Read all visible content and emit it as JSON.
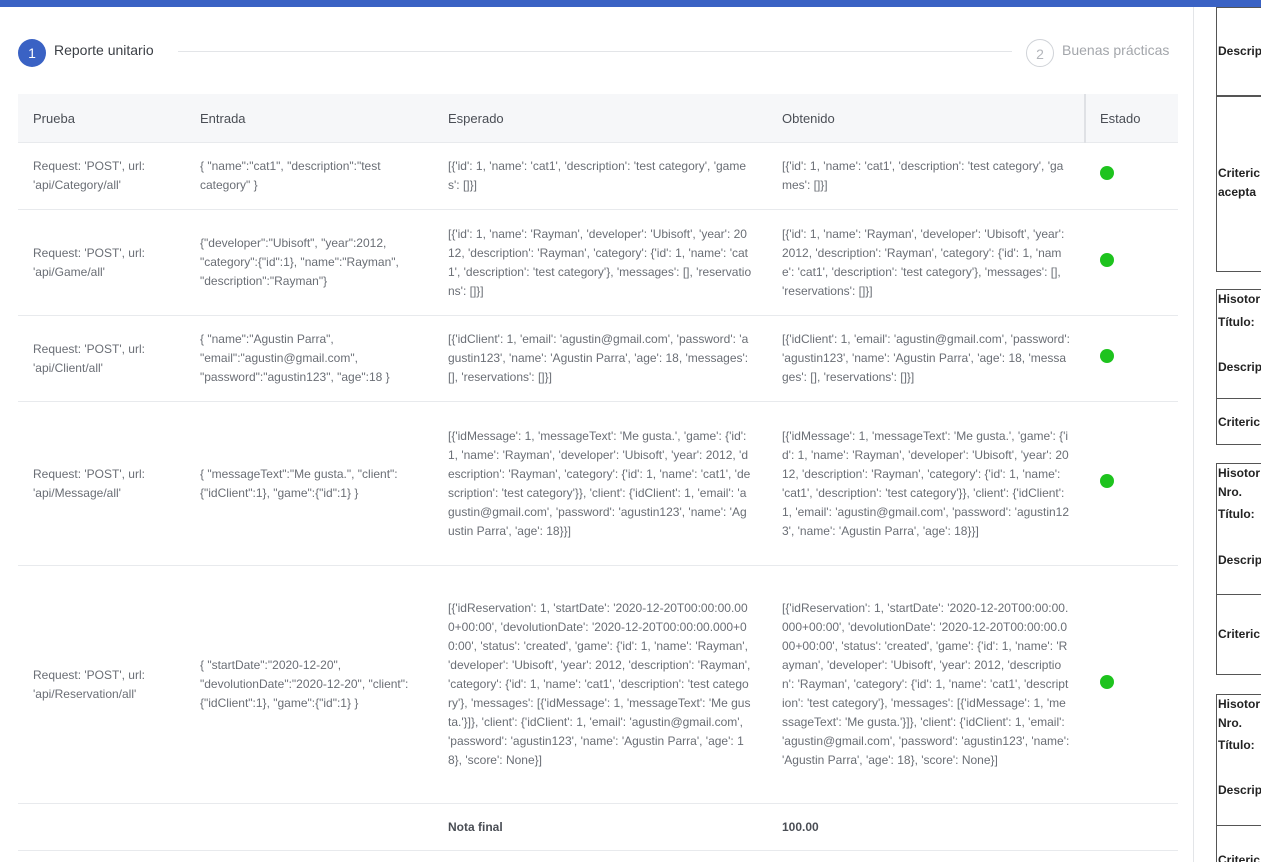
{
  "stepper": {
    "steps": [
      {
        "number": "1",
        "label": "Reporte unitario"
      },
      {
        "number": "2",
        "label": "Buenas prácticas"
      }
    ]
  },
  "table": {
    "headers": [
      "Prueba",
      "Entrada",
      "Esperado",
      "Obtenido",
      "Estado"
    ],
    "rows": [
      {
        "prueba": "Request: 'POST', url: 'api/Category/all'",
        "entrada": "{ \"name\":\"cat1\", \"description\":\"test category\" }",
        "esperado": "[{'id': 1, 'name': 'cat1', 'description': 'test category', 'games': []}]",
        "obtenido": "[{'id': 1, 'name': 'cat1', 'description': 'test category', 'games': []}]",
        "estado": "ok"
      },
      {
        "prueba": "Request: 'POST', url: 'api/Game/all'",
        "entrada": "{\"developer\":\"Ubisoft\", \"year\":2012, \"category\":{\"id\":1}, \"name\":\"Rayman\", \"description\":\"Rayman\"}",
        "esperado": "[{'id': 1, 'name': 'Rayman', 'developer': 'Ubisoft', 'year': 2012, 'description': 'Rayman', 'category': {'id': 1, 'name': 'cat1', 'description': 'test category'}, 'messages': [], 'reservations': []}]",
        "obtenido": "[{'id': 1, 'name': 'Rayman', 'developer': 'Ubisoft', 'year': 2012, 'description': 'Rayman', 'category': {'id': 1, 'name': 'cat1', 'description': 'test category'}, 'messages': [], 'reservations': []}]",
        "estado": "ok"
      },
      {
        "prueba": "Request: 'POST', url: 'api/Client/all'",
        "entrada": "{ \"name\":\"Agustin Parra\", \"email\":\"agustin@gmail.com\", \"password\":\"agustin123\", \"age\":18 }",
        "esperado": "[{'idClient': 1, 'email': 'agustin@gmail.com', 'password': 'agustin123', 'name': 'Agustin Parra', 'age': 18, 'messages': [], 'reservations': []}]",
        "obtenido": "[{'idClient': 1, 'email': 'agustin@gmail.com', 'password': 'agustin123', 'name': 'Agustin Parra', 'age': 18, 'messages': [], 'reservations': []}]",
        "estado": "ok"
      },
      {
        "prueba": "Request: 'POST', url: 'api/Message/all'",
        "entrada": "{ \"messageText\":\"Me gusta.\", \"client\":{\"idClient\":1}, \"game\":{\"id\":1} }",
        "esperado": "[{'idMessage': 1, 'messageText': 'Me gusta.', 'game': {'id': 1, 'name': 'Rayman', 'developer': 'Ubisoft', 'year': 2012, 'description': 'Rayman', 'category': {'id': 1, 'name': 'cat1', 'description': 'test category'}}, 'client': {'idClient': 1, 'email': 'agustin@gmail.com', 'password': 'agustin123', 'name': 'Agustin Parra', 'age': 18}}]",
        "obtenido": "[{'idMessage': 1, 'messageText': 'Me gusta.', 'game': {'id': 1, 'name': 'Rayman', 'developer': 'Ubisoft', 'year': 2012, 'description': 'Rayman', 'category': {'id': 1, 'name': 'cat1', 'description': 'test category'}}, 'client': {'idClient': 1, 'email': 'agustin@gmail.com', 'password': 'agustin123', 'name': 'Agustin Parra', 'age': 18}}]",
        "estado": "ok"
      },
      {
        "prueba": "Request: 'POST', url: 'api/Reservation/all'",
        "entrada": "{ \"startDate\":\"2020-12-20\", \"devolutionDate\":\"2020-12-20\", \"client\":{\"idClient\":1}, \"game\":{\"id\":1} }",
        "esperado": "[{'idReservation': 1, 'startDate': '2020-12-20T00:00:00.000+00:00', 'devolutionDate': '2020-12-20T00:00:00.000+00:00', 'status': 'created', 'game': {'id': 1, 'name': 'Rayman', 'developer': 'Ubisoft', 'year': 2012, 'description': 'Rayman', 'category': {'id': 1, 'name': 'cat1', 'description': 'test category'}, 'messages': [{'idMessage': 1, 'messageText': 'Me gusta.'}]}, 'client': {'idClient': 1, 'email': 'agustin@gmail.com', 'password': 'agustin123', 'name': 'Agustin Parra', 'age': 18}, 'score': None}]",
        "obtenido": "[{'idReservation': 1, 'startDate': '2020-12-20T00:00:00.000+00:00', 'devolutionDate': '2020-12-20T00:00:00.000+00:00', 'status': 'created', 'game': {'id': 1, 'name': 'Rayman', 'developer': 'Ubisoft', 'year': 2012, 'description': 'Rayman', 'category': {'id': 1, 'name': 'cat1', 'description': 'test category'}, 'messages': [{'idMessage': 1, 'messageText': 'Me gusta.'}]}, 'client': {'idClient': 1, 'email': 'agustin@gmail.com', 'password': 'agustin123', 'name': 'Agustin Parra', 'age': 18}, 'score': None}]",
        "estado": "ok"
      }
    ],
    "final_label": "Nota final",
    "final_value": "100.00"
  },
  "sidebar": {
    "labels": [
      "Descrip",
      "Criteric",
      "acepta",
      "Hisotor",
      "Título:",
      "Descrip",
      "Criteric",
      "Hisotor",
      "Nro.",
      "Título:",
      "Descrip",
      "Criteric",
      "Hisotor",
      "Nro.",
      "Título:",
      "Descrip",
      "Criteric"
    ]
  },
  "colors": {
    "accent": "#3a62c4",
    "status_ok": "#1ec31e"
  }
}
